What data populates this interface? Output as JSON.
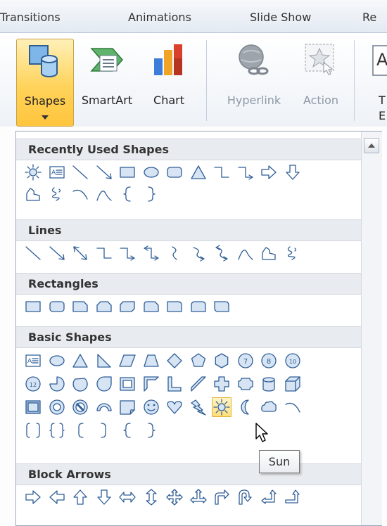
{
  "tabs": [
    {
      "label": "Transitions"
    },
    {
      "label": "Animations"
    },
    {
      "label": "Slide Show"
    },
    {
      "label": "Re"
    }
  ],
  "ribbon": {
    "shapes_label": "Shapes",
    "smartart_label": "SmartArt",
    "chart_label": "Chart",
    "hyperlink_label": "Hyperlink",
    "action_label": "Action",
    "partial_label_1": "T",
    "partial_label_2": "E"
  },
  "sections": [
    {
      "title": "Recently Used Shapes"
    },
    {
      "title": "Lines"
    },
    {
      "title": "Rectangles"
    },
    {
      "title": "Basic Shapes"
    },
    {
      "title": "Block Arrows"
    }
  ],
  "tooltip": {
    "text": "Sun"
  },
  "colors": {
    "shape_fill": "#d6e4f4",
    "shape_stroke": "#2f5e96",
    "hover_fill": "#ffe38a",
    "ribbon_selected": "#ffd35a"
  }
}
